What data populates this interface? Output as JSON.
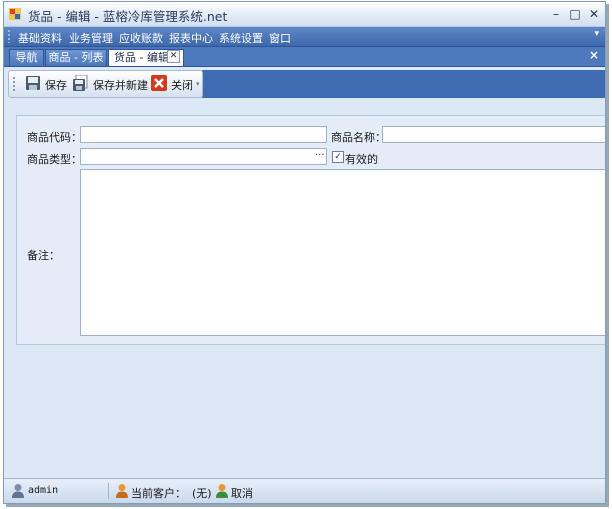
{
  "window": {
    "title": "货品 - 编辑 - 蓝榕冷库管理系统.net",
    "minimize": "–",
    "maximize": "□",
    "close": "✕"
  },
  "menu": {
    "items": [
      "基础资料",
      "业务管理",
      "应收账款",
      "报表中心",
      "系统设置",
      "窗口"
    ],
    "more": "▾"
  },
  "tabs": {
    "items": [
      {
        "label": "导航"
      },
      {
        "label": "商品 - 列表"
      },
      {
        "label": "货品 - 编辑",
        "active": true
      }
    ],
    "tab_close": "✕",
    "doc_close": "×"
  },
  "toolbar": {
    "save": "保存",
    "save_new": "保存并新建",
    "close": "关闭",
    "dropdown": "▾"
  },
  "form": {
    "code_label": "商品代码：",
    "code_value": "",
    "name_label": "商品名称：",
    "name_value": "",
    "type_label": "商品类型：",
    "type_value": "",
    "type_button": "···",
    "valid_label": "有效的",
    "valid_checked": "✓",
    "notes_label": "备注：",
    "notes_value": ""
  },
  "status": {
    "user": "admin",
    "customer_label": "当前客户：",
    "customer_value": "(无)",
    "cancel": "取消"
  }
}
